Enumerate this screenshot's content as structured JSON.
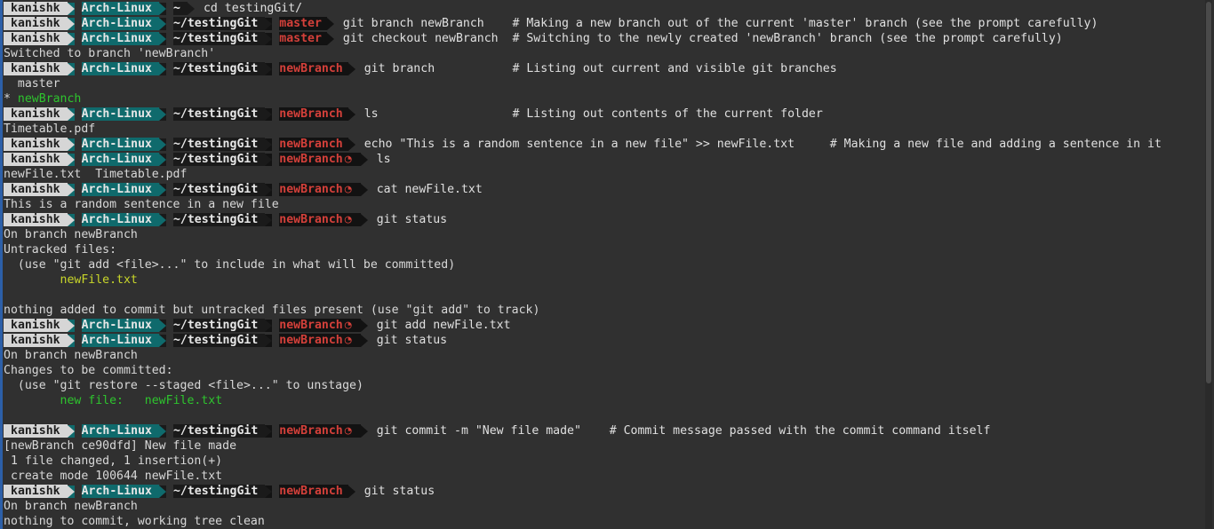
{
  "prompt": {
    "user": "kanishk",
    "host": "Arch-Linux",
    "dirty_symbol": "◔"
  },
  "lines": [
    {
      "type": "prompt",
      "path": "~",
      "branch": "",
      "dirty": false,
      "cmd": "cd testingGit/"
    },
    {
      "type": "prompt",
      "path": "~/testingGit",
      "branch": "master",
      "dirty": false,
      "cmd": "git branch newBranch    # Making a new branch out of the current 'master' branch (see the prompt carefully)"
    },
    {
      "type": "prompt",
      "path": "~/testingGit",
      "branch": "master",
      "dirty": false,
      "cmd": "git checkout newBranch  # Switching to the newly created 'newBranch' branch (see the prompt carefully)"
    },
    {
      "type": "out",
      "text": "Switched to branch 'newBranch'"
    },
    {
      "type": "prompt",
      "path": "~/testingGit",
      "branch": "newBranch",
      "dirty": false,
      "cmd": "git branch           # Listing out current and visible git branches"
    },
    {
      "type": "out",
      "text": "  master"
    },
    {
      "type": "mixed",
      "parts": [
        {
          "text": "* ",
          "color": ""
        },
        {
          "text": "newBranch",
          "color": "green"
        }
      ]
    },
    {
      "type": "prompt",
      "path": "~/testingGit",
      "branch": "newBranch",
      "dirty": false,
      "cmd": "ls                   # Listing out contents of the current folder"
    },
    {
      "type": "out",
      "text": "Timetable.pdf"
    },
    {
      "type": "prompt",
      "path": "~/testingGit",
      "branch": "newBranch",
      "dirty": false,
      "cmd": "echo \"This is a random sentence in a new file\" >> newFile.txt     # Making a new file and adding a sentence in it"
    },
    {
      "type": "prompt",
      "path": "~/testingGit",
      "branch": "newBranch",
      "dirty": true,
      "cmd": "ls"
    },
    {
      "type": "out",
      "text": "newFile.txt  Timetable.pdf"
    },
    {
      "type": "prompt",
      "path": "~/testingGit",
      "branch": "newBranch",
      "dirty": true,
      "cmd": "cat newFile.txt"
    },
    {
      "type": "out",
      "text": "This is a random sentence in a new file"
    },
    {
      "type": "prompt",
      "path": "~/testingGit",
      "branch": "newBranch",
      "dirty": true,
      "cmd": "git status"
    },
    {
      "type": "out",
      "text": "On branch newBranch"
    },
    {
      "type": "out",
      "text": "Untracked files:"
    },
    {
      "type": "out",
      "text": "  (use \"git add <file>...\" to include in what will be committed)"
    },
    {
      "type": "mixed",
      "parts": [
        {
          "text": "        ",
          "color": ""
        },
        {
          "text": "newFile.txt",
          "color": "yellow"
        }
      ]
    },
    {
      "type": "blank"
    },
    {
      "type": "out",
      "text": "nothing added to commit but untracked files present (use \"git add\" to track)"
    },
    {
      "type": "prompt",
      "path": "~/testingGit",
      "branch": "newBranch",
      "dirty": true,
      "cmd": "git add newFile.txt"
    },
    {
      "type": "prompt",
      "path": "~/testingGit",
      "branch": "newBranch",
      "dirty": true,
      "cmd": "git status"
    },
    {
      "type": "out",
      "text": "On branch newBranch"
    },
    {
      "type": "out",
      "text": "Changes to be committed:"
    },
    {
      "type": "out",
      "text": "  (use \"git restore --staged <file>...\" to unstage)"
    },
    {
      "type": "mixed",
      "parts": [
        {
          "text": "        ",
          "color": ""
        },
        {
          "text": "new file:   newFile.txt",
          "color": "green"
        }
      ]
    },
    {
      "type": "blank"
    },
    {
      "type": "prompt",
      "path": "~/testingGit",
      "branch": "newBranch",
      "dirty": true,
      "cmd": "git commit -m \"New file made\"    # Commit message passed with the commit command itself"
    },
    {
      "type": "out",
      "text": "[newBranch ce90dfd] New file made"
    },
    {
      "type": "out",
      "text": " 1 file changed, 1 insertion(+)"
    },
    {
      "type": "out",
      "text": " create mode 100644 newFile.txt"
    },
    {
      "type": "prompt",
      "path": "~/testingGit",
      "branch": "newBranch",
      "dirty": false,
      "cmd": "git status"
    },
    {
      "type": "out",
      "text": "On branch newBranch"
    },
    {
      "type": "out",
      "text": "nothing to commit, working tree clean"
    }
  ],
  "colors": {
    "background": "#303030",
    "host_segment": "#0f6a6c",
    "branch_text": "#d4403a",
    "green_output": "#2ec42e",
    "yellow_output": "#c8d62a"
  }
}
